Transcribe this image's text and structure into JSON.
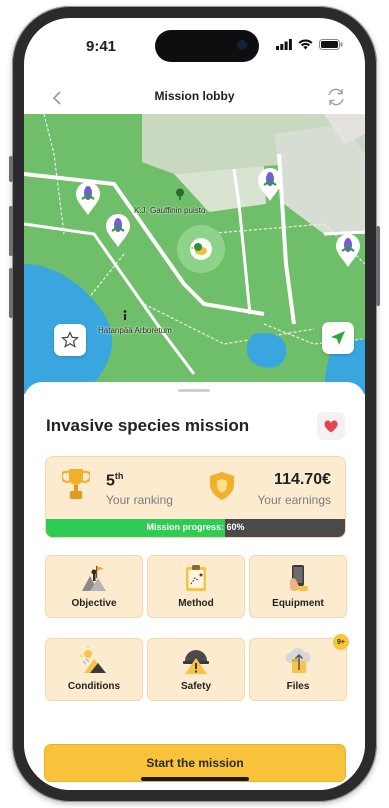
{
  "status_bar": {
    "time": "9:41"
  },
  "nav": {
    "title": "Mission lobby"
  },
  "map": {
    "labels": {
      "park": "K.J. Gauffinin puisto",
      "arboretum": "Hatanpää Arboretum"
    }
  },
  "mission": {
    "title": "Invasive species mission",
    "ranking": {
      "value": "5",
      "suffix": "th",
      "label": "Your ranking"
    },
    "earnings": {
      "value": "114.70€",
      "label": "Your earnings"
    },
    "progress": {
      "fraction": 0.6,
      "label": "Mission progress: 60%"
    }
  },
  "tiles": [
    {
      "label": "Objective",
      "icon": "summit-flag-icon"
    },
    {
      "label": "Method",
      "icon": "clipboard-icon"
    },
    {
      "label": "Equipment",
      "icon": "phone-in-hand-icon"
    },
    {
      "label": "Conditions",
      "icon": "weather-icon"
    },
    {
      "label": "Safety",
      "icon": "hard-hat-warning-icon"
    },
    {
      "label": "Files",
      "icon": "cloud-upload-folder-icon",
      "badge": "9+"
    }
  ],
  "actions": {
    "start_label": "Start the mission"
  },
  "colors": {
    "accent_yellow": "#f8c33a",
    "tile_bg": "#fdebd0",
    "progress_green": "#2ecc55",
    "map_green": "#6fbf6a",
    "water_blue": "#3aa6e0",
    "heart_red": "#e8434c"
  }
}
